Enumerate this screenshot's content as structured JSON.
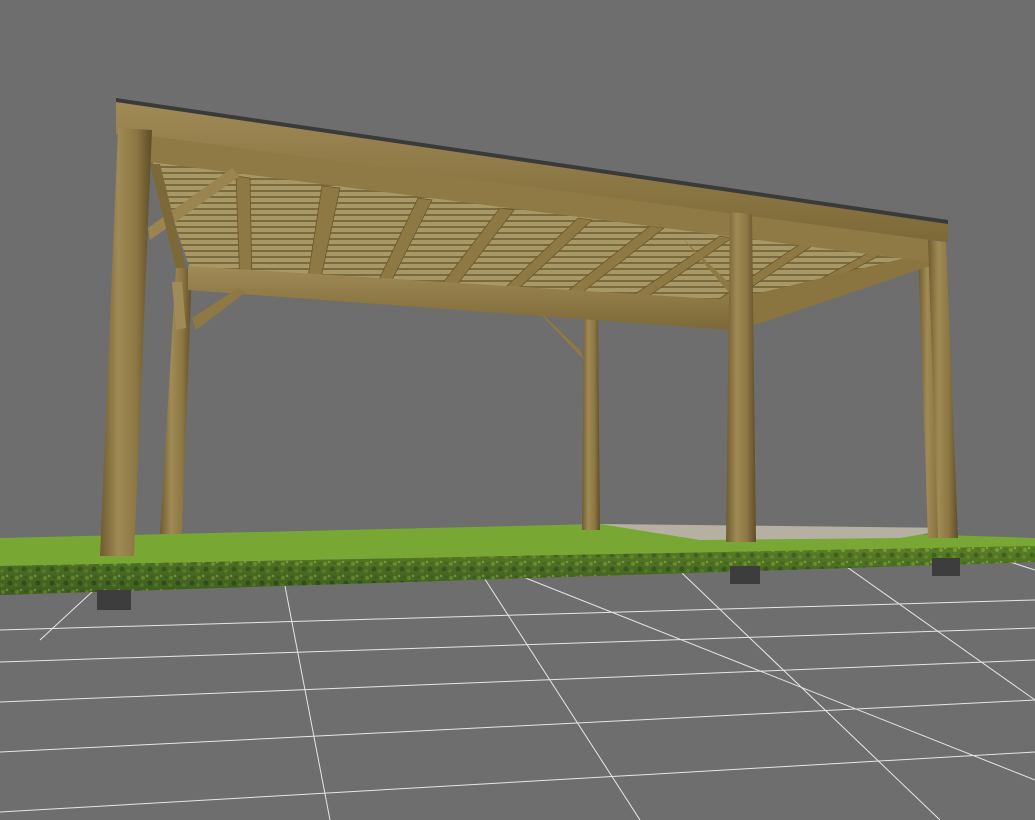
{
  "viewport": {
    "background_color": "#6e6e6e",
    "grid_line_color": "#e6e6e6",
    "grid_fill_color": "#6f6f6f"
  },
  "scene": {
    "object": "carport-pergola-model",
    "materials": {
      "timber_light": "#9a8650",
      "timber_mid": "#86713e",
      "timber_dark": "#5e4d28",
      "grass_top": "#7aa832",
      "grass_edge_light": "#6f8f2c",
      "grass_edge_dark": "#2f4a1c",
      "gravel": "#b8b3a4",
      "footing": "#3d3d3d",
      "roof_sheet": "#3a3a3a"
    }
  }
}
